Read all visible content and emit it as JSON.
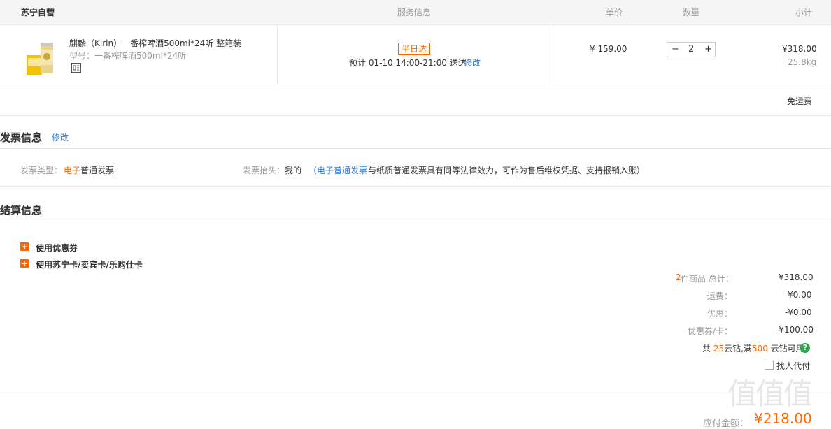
{
  "header": {
    "store": "苏宁自营",
    "service": "服务信息",
    "unit_price": "单价",
    "quantity": "数量",
    "subtotal": "小计"
  },
  "item": {
    "title": "麒麟（Kirin）一番榨啤酒500ml*24听 整箱装",
    "model": "型号：一番榨啤酒500ml*24听",
    "badge": "半日达",
    "delivery": "预计 01-10 14:00-21:00  送达",
    "modify": "修改",
    "price": "¥ 159.00",
    "qty": "2",
    "minus": "−",
    "plus": "+",
    "subtotal": "¥318.00",
    "weight": "25.8kg"
  },
  "shipping_note": "免运费",
  "invoice": {
    "title": "发票信息",
    "modify": "修改",
    "type_label": "发票类型：",
    "type_value_hl": "电子",
    "type_value": "普通发票",
    "head_label": "发票抬头：",
    "head_value": "我的",
    "note_open": "（",
    "note_link": "电子普通发票",
    "note_text": "与纸质普通发票具有同等法律效力，可作为售后维权凭据、支持报销入账）"
  },
  "settle": {
    "title": "结算信息",
    "coupon": "使用优惠券",
    "cards": "使用苏宁卡/卖宾卡/乐购仕卡",
    "count": "2",
    "total_label": "件商品 总计：",
    "total_value": "¥318.00",
    "freight_label": "运费：",
    "freight_value": "¥0.00",
    "discount_label": "优惠：",
    "discount_value": "-¥0.00",
    "coupon_label": "优惠券/卡：",
    "coupon_value": "-¥100.00",
    "diamond_prefix": "共 ",
    "diamond_have": "25",
    "diamond_mid": "云钻,满",
    "diamond_need": "500",
    "diamond_suffix": " 云钻可用",
    "proxy_pay": "找人代付",
    "payable_label": "应付金额：",
    "payable_value": "¥218.00"
  },
  "icons": {
    "help": "?",
    "expand": "+"
  },
  "watermark": "值值值"
}
